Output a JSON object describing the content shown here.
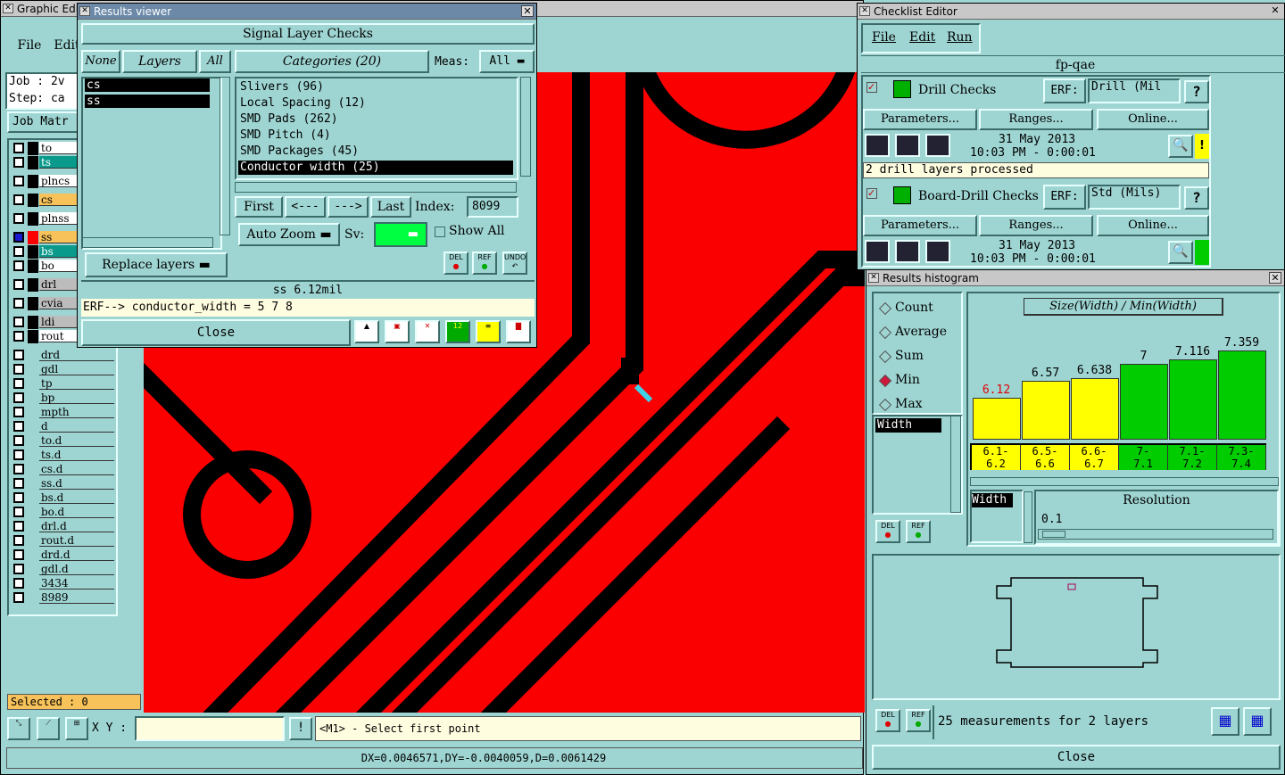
{
  "graphic_editor": {
    "title": "Graphic Edi",
    "menu": [
      "File",
      "Edit"
    ],
    "job_label": "Job : 2v",
    "step_label": "Step: ca",
    "job_matrix_btn": "Job Matr",
    "layers": [
      "to",
      "ts",
      "plncs",
      "cs",
      "plnss",
      "ss",
      "bs",
      "bo",
      "drl",
      "cvia",
      "ldi",
      "rout",
      "drd",
      "gdl",
      "tp",
      "bp",
      "mpth",
      "d",
      "to.d",
      "ts.d",
      "cs.d",
      "ss.d",
      "bs.d",
      "bo.d",
      "drl.d",
      "rout.d",
      "drd.d",
      "gdl.d",
      "3434",
      "8989"
    ],
    "selected": "Selected : 0",
    "xy_label": "X Y :",
    "xy_value": "",
    "status_prompt": "<M1> - Select first point",
    "coords": "DX=0.0046571,DY=-0.0040059,D=0.0061429",
    "colors": {
      "canvas": "#fa0000",
      "trace": "#000000",
      "marker": "#3fd1e6"
    }
  },
  "results_viewer": {
    "title": "Results viewer",
    "header": "Signal Layer Checks",
    "none_btn": "None",
    "layers_btn": "Layers",
    "all_btn": "All",
    "categories_btn": "Categories (20)",
    "meas_label": "Meas:",
    "meas_value": "All",
    "layer_list": [
      "cs",
      "ss"
    ],
    "categories": [
      "Slivers (96)",
      "Local Spacing (12)",
      "SMD Pads (262)",
      "SMD Pitch (4)",
      "SMD Packages (45)",
      "Conductor width (25)"
    ],
    "nav": {
      "first": "First",
      "prev": "<---",
      "next": "--->",
      "last": "Last",
      "index_label": "Index:",
      "index_value": "8099"
    },
    "auto_zoom": "Auto Zoom",
    "sv_label": "Sv:",
    "show_all": "Show All",
    "replace_layers": "Replace layers",
    "icon_labels": {
      "del": "DEL",
      "ref": "REF",
      "undo": "UNDO"
    },
    "measurement": "ss 6.12mil",
    "erf_line": "ERF--> conductor_width = 5 7 8",
    "close": "Close"
  },
  "checklist_editor": {
    "title": "Checklist Editor",
    "menu": [
      "File",
      "Edit",
      "Run"
    ],
    "name": "fp-qae",
    "checks": [
      {
        "name": "Drill Checks",
        "erf_label": "ERF:",
        "erf_value": "Drill (Mil",
        "date": "31 May 2013",
        "time": "10:03 PM - 0:00:01",
        "status": "2 drill layers processed",
        "status_mark": "!"
      },
      {
        "name": "Board-Drill Checks",
        "erf_label": "ERF:",
        "erf_value": "Std (Mils)",
        "date": "31 May 2013",
        "time": "10:03 PM - 0:00:01"
      }
    ],
    "parameters_btn": "Parameters...",
    "ranges_btn": "Ranges...",
    "online_btn": "Online...",
    "help_btn": "?"
  },
  "histogram": {
    "title": "Results histogram",
    "modes": [
      "Count",
      "Average",
      "Sum",
      "Min",
      "Max"
    ],
    "selected_mode": "Min",
    "field": "Width",
    "chart_title": "Size(Width) / Min(Width)",
    "bins": [
      "6.1-6.2",
      "6.5-6.6",
      "6.6-6.7",
      "7-7.1",
      "7.1-7.2",
      "7.3-7.4"
    ],
    "bin_labels_top": [
      "6.1-",
      "6.5-",
      "6.6-",
      "7-",
      "7.1-",
      "7.3-"
    ],
    "bin_labels_bottom": [
      "6.2",
      "6.6",
      "6.7",
      "7.1",
      "7.2",
      "7.4"
    ],
    "values": [
      6.12,
      6.57,
      6.638,
      7,
      7.116,
      7.359
    ],
    "value_labels": [
      "6.12",
      "6.57",
      "6.638",
      "7",
      "7.116",
      "7.359"
    ],
    "bar_colors": [
      "#ffff00",
      "#ffff00",
      "#ffff00",
      "#00cc00",
      "#00cc00",
      "#00cc00"
    ],
    "highlight_value_color": "#e00000",
    "resolution_label": "Resolution",
    "resolution_value": "0.1",
    "field_list": [
      "Width"
    ],
    "summary": "25 measurements for 2 layers",
    "close": "Close",
    "icon_labels": {
      "del": "DEL",
      "ref": "REF"
    }
  },
  "chart_data": {
    "type": "bar",
    "title": "Size(Width) / Min(Width)",
    "categories": [
      "6.1-6.2",
      "6.5-6.6",
      "6.6-6.7",
      "7-7.1",
      "7.1-7.2",
      "7.3-7.4"
    ],
    "values": [
      6.12,
      6.57,
      6.638,
      7,
      7.116,
      7.359
    ],
    "xlabel": "",
    "ylabel": ""
  }
}
